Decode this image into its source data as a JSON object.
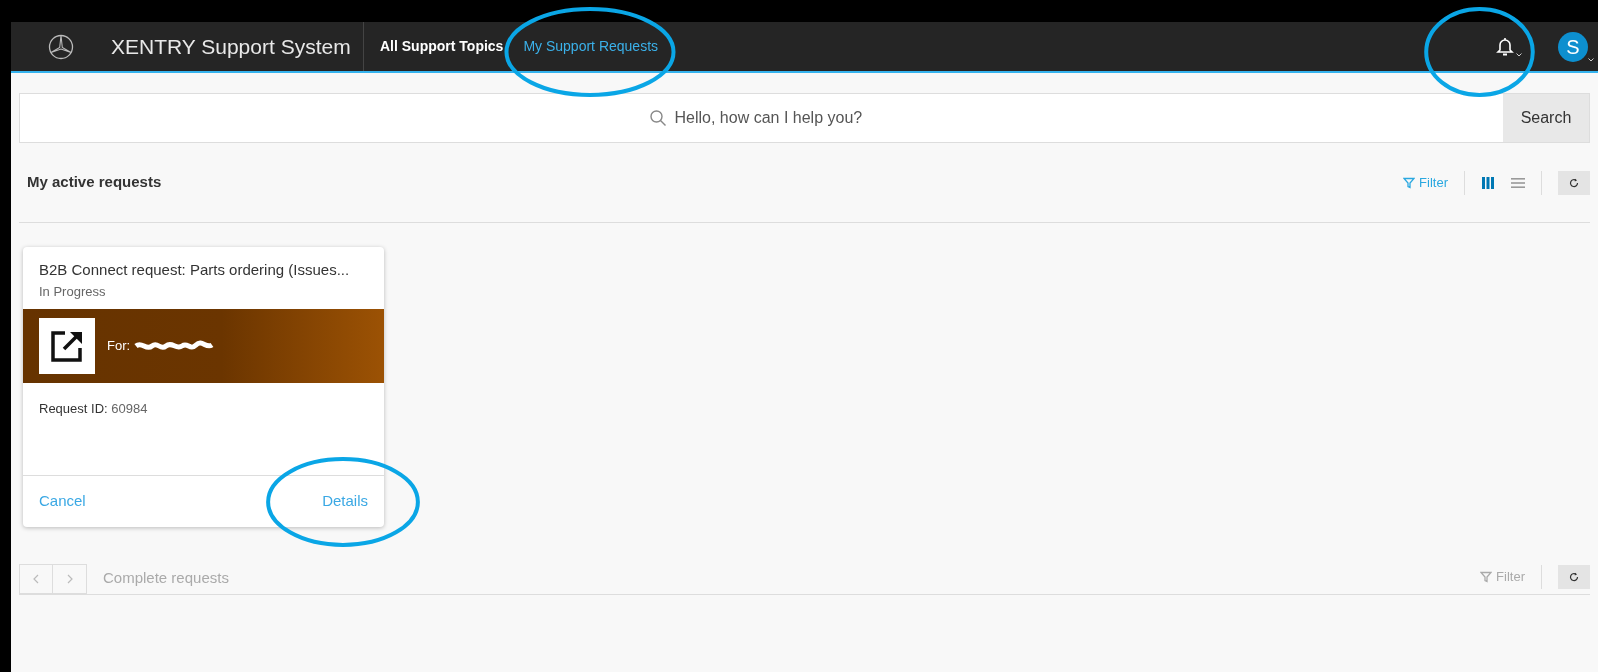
{
  "header": {
    "title": "XENTRY Support System",
    "nav": [
      {
        "label": "All Support Topics",
        "selected": false
      },
      {
        "label": "My Support Requests",
        "selected": true
      }
    ],
    "avatar": "S"
  },
  "search": {
    "placeholder": "Hello, how can I help you?",
    "button": "Search"
  },
  "active_requests": {
    "title": "My active requests",
    "filter": "Filter",
    "view_modes": [
      {
        "kind": "columns",
        "selected": true
      },
      {
        "kind": "list",
        "selected": false
      }
    ],
    "cards": [
      {
        "title": "B2B Connect request: Parts ordering (Issues...",
        "status": "In Progress",
        "for": "For:",
        "request_id_label": "Request ID:",
        "request_id": "60984",
        "actions": [
          "Cancel",
          "Details"
        ]
      }
    ]
  },
  "complete_requests": {
    "title": "Complete requests",
    "filter": "Filter"
  }
}
